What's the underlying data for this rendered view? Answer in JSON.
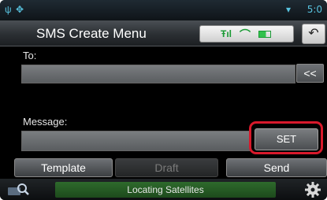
{
  "status": {
    "time": "5:0",
    "left_icons": [
      "usb-icon",
      "notification-icon"
    ],
    "wifi_icon": "wifi-icon"
  },
  "header": {
    "title": "SMS Create Menu",
    "back_icon": "back-icon"
  },
  "connection": {
    "signal_icon": "signal-icon",
    "connected_icon": "phone-link-icon",
    "battery_icon": "battery-icon"
  },
  "to": {
    "label": "To:",
    "value": "",
    "side_button": "<<"
  },
  "message": {
    "label": "Message:",
    "value": "",
    "set_button": "SET"
  },
  "actions": {
    "template": "Template",
    "draft": "Draft",
    "send": "Send"
  },
  "footer": {
    "status_text": "Locating Satellites",
    "search_icon": "map-search-icon",
    "settings_icon": "gear-icon"
  },
  "colors": {
    "highlight": "#d8192b",
    "status_accent": "#58c4e0",
    "footer_green": "#2e6a2c"
  }
}
